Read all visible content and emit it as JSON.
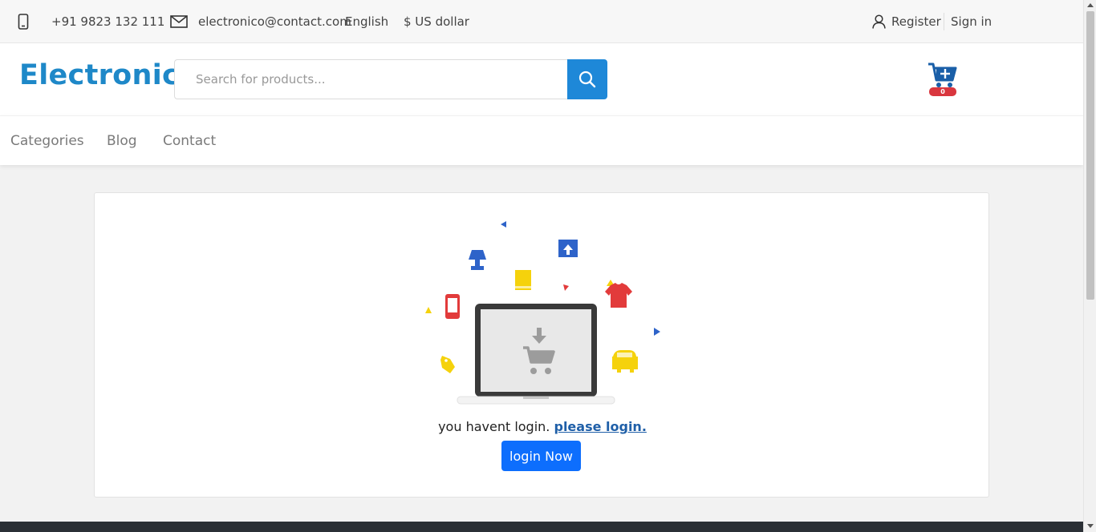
{
  "topbar": {
    "phone": "+91 9823 132 111",
    "email": "electronico@contact.com",
    "language": "English",
    "currency": "$ US dollar",
    "register": "Register",
    "signin": "Sign in"
  },
  "header": {
    "logo": "Electronic",
    "search_placeholder": "Search for products...",
    "cart_count": "0"
  },
  "nav": {
    "items": [
      "Categories",
      "Blog",
      "Contact"
    ]
  },
  "main": {
    "message": "you havent login.",
    "login_link": "please login.",
    "login_button": "login Now"
  },
  "colors": {
    "brand": "#1e88c8",
    "search_button": "#1e88d8",
    "primary_button": "#0d6efd",
    "cart_badge": "#d9363e",
    "footer": "#2b3036"
  },
  "icons": {
    "phone": "phone-icon",
    "email": "envelope-icon",
    "user": "user-icon",
    "search": "search-icon",
    "cart": "cart-add-icon"
  }
}
